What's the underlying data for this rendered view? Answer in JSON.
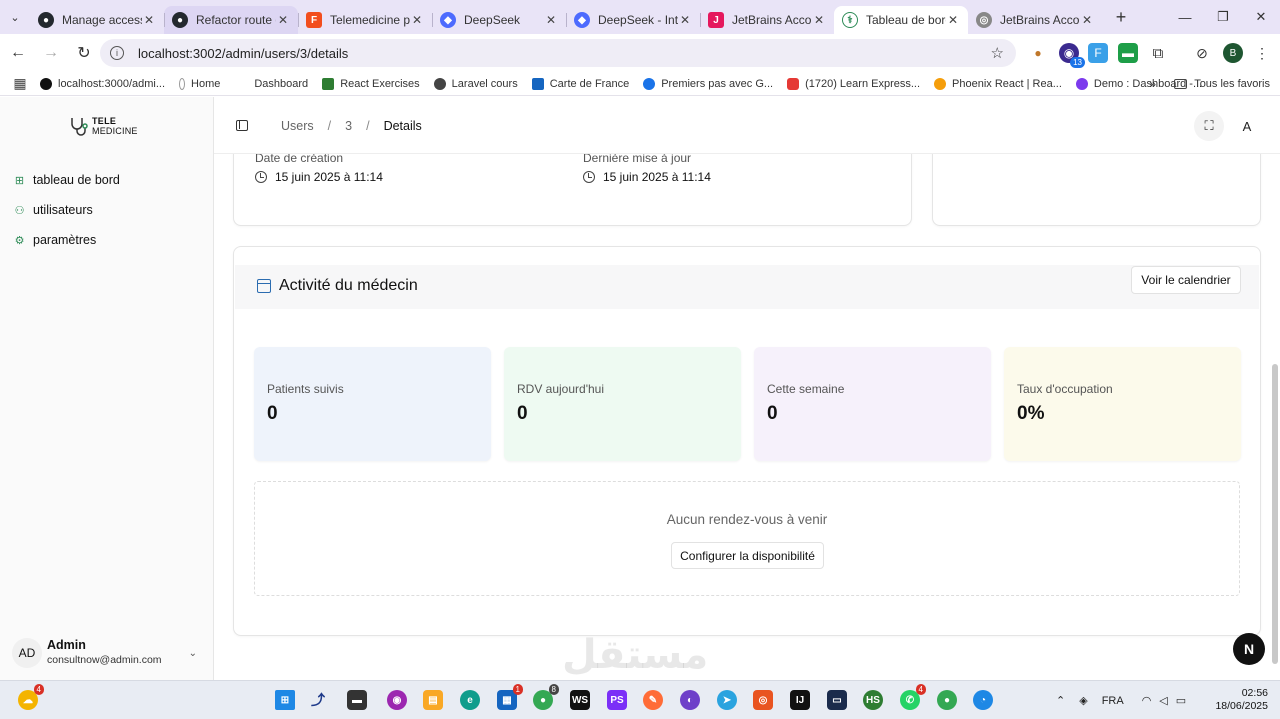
{
  "browser": {
    "tabs": [
      {
        "label": "Manage access",
        "color": "#24292f"
      },
      {
        "label": "Refactor route d",
        "color": "#24292f"
      },
      {
        "label": "Telemedicine pla",
        "color": "#f24e1e"
      },
      {
        "label": "DeepSeek",
        "color": "#4d6bfe"
      },
      {
        "label": "DeepSeek - Into",
        "color": "#4d6bfe"
      },
      {
        "label": "JetBrains Accour",
        "color": "#e5185d"
      },
      {
        "label": "Tableau de bord",
        "color": "#2e8b57"
      },
      {
        "label": "JetBrains Accour",
        "color": "#555555"
      }
    ],
    "url": "localhost:3002/admin/users/3/details",
    "ext_badge": "13",
    "profile_initial": "B",
    "bookmarks": [
      {
        "label": "localhost:3000/admi...",
        "color": "#111111"
      },
      {
        "label": "Home",
        "color": "#333333"
      },
      {
        "label": "Dashboard",
        "color": "#ffffff"
      },
      {
        "label": "React Exercises",
        "color": "#2e7d32"
      },
      {
        "label": "Laravel cours",
        "color": "#444444"
      },
      {
        "label": "Carte de France",
        "color": "#1565c0"
      },
      {
        "label": "Premiers pas avec G...",
        "color": "#1a73e8"
      },
      {
        "label": "(1720) Learn Express...",
        "color": "#e53935"
      },
      {
        "label": "Phoenix React | Rea...",
        "color": "#f59e0b"
      },
      {
        "label": "Demo : Dashboard -...",
        "color": "#7c3aed"
      }
    ],
    "all_bookmarks": "Tous les favoris"
  },
  "app": {
    "logo": {
      "line1": "TELE",
      "line2": "MEDICINE"
    },
    "nav": [
      {
        "label": "tableau de bord",
        "icon": "grid-icon"
      },
      {
        "label": "utilisateurs",
        "icon": "users-icon"
      },
      {
        "label": "paramètres",
        "icon": "settings-icon"
      }
    ],
    "user": {
      "initials": "AD",
      "name": "Admin",
      "email": "consultnow@admin.com"
    },
    "breadcrumb": [
      "Users",
      "3",
      "Details"
    ],
    "header_avatar": "A",
    "accent": "#2e8b57"
  },
  "details": {
    "created_label": "Date de création",
    "created_value": "15 juin 2025 à 11:14",
    "updated_label": "Dernière mise à jour",
    "updated_value": "15 juin 2025 à 11:14"
  },
  "activity": {
    "title": "Activité du médecin",
    "calendar_button": "Voir le calendrier",
    "stats": [
      {
        "label": "Patients suivis",
        "value": "0",
        "bg": "#eef3fb"
      },
      {
        "label": "RDV aujourd'hui",
        "value": "0",
        "bg": "#eefaf2"
      },
      {
        "label": "Cette semaine",
        "value": "0",
        "bg": "#f6f1fb"
      },
      {
        "label": "Taux d'occupation",
        "value": "0%",
        "bg": "#fcfaeb"
      }
    ],
    "empty_text": "Aucun rendez-vous à venir",
    "config_button": "Configurer la disponibilité"
  },
  "floating_badge": "N",
  "taskbar": {
    "weather_badge": "4",
    "mail_badge": "1",
    "chrome_badge": "8",
    "whatsapp_badge": "4",
    "language": "FRA",
    "time": "02:56",
    "date": "18/06/2025"
  },
  "watermark": "مستقل"
}
